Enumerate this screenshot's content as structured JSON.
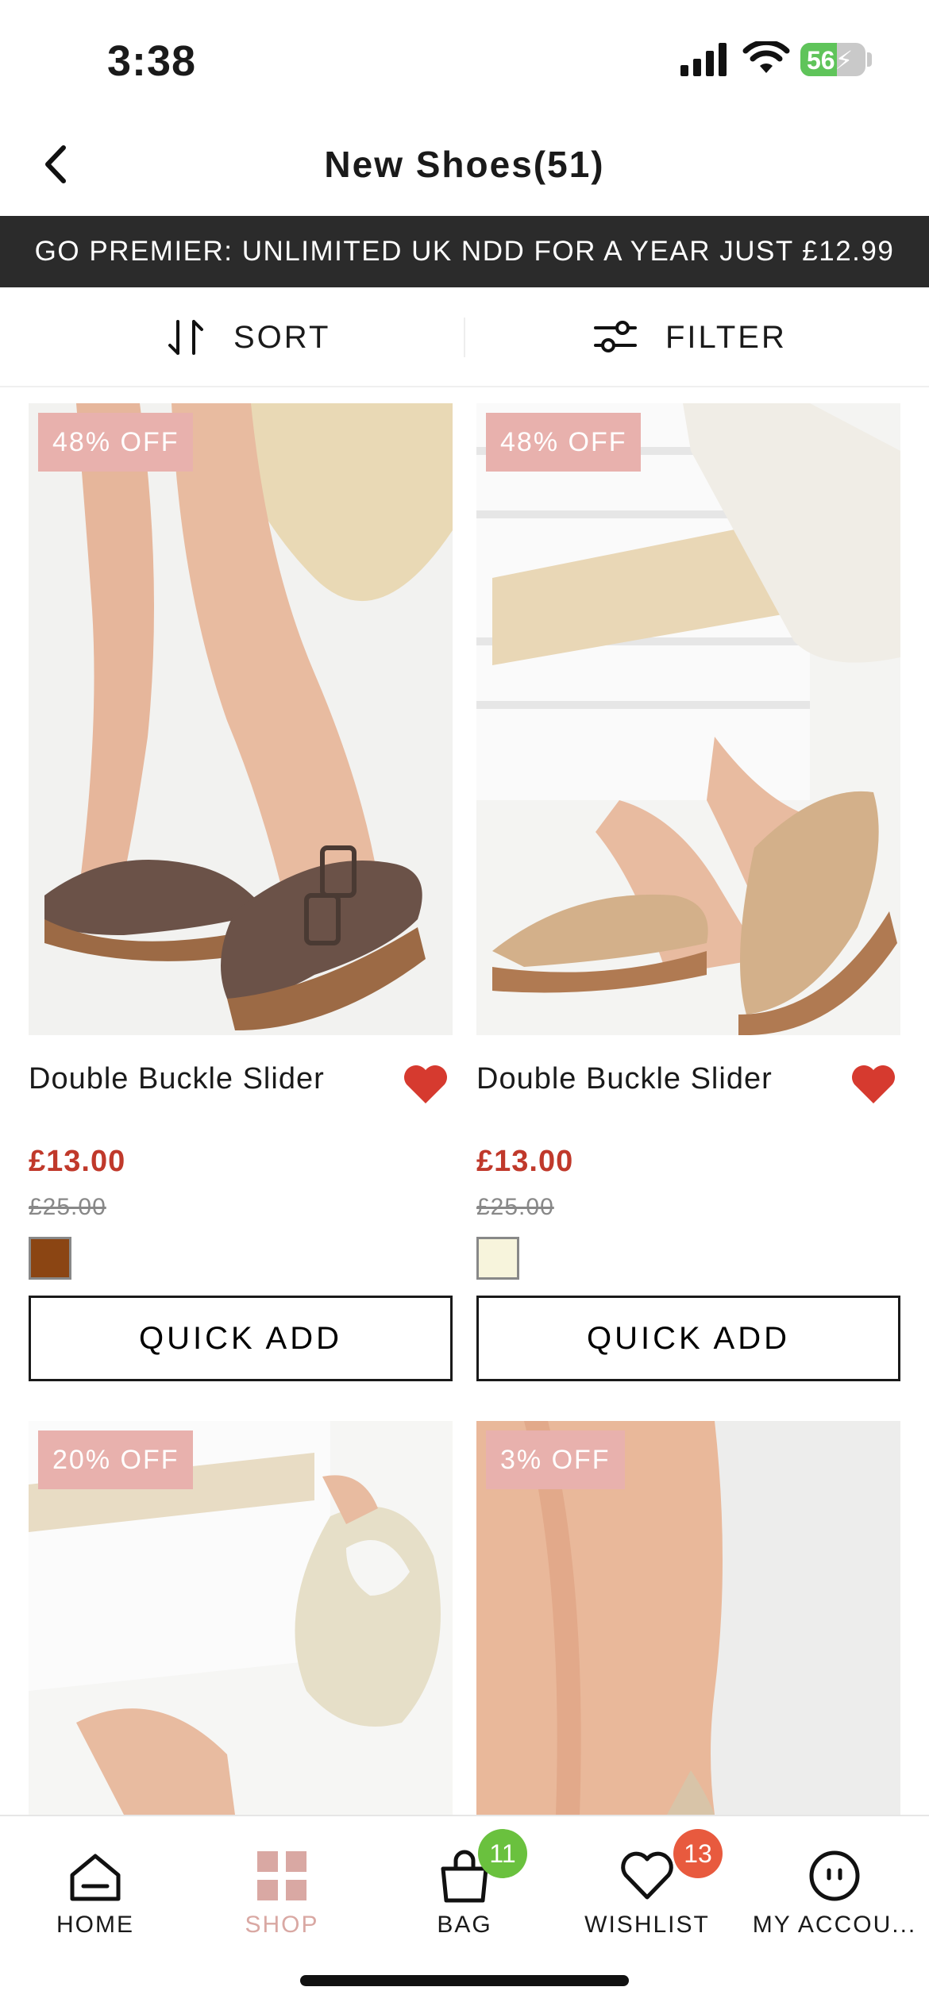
{
  "status_bar": {
    "time": "3:38",
    "battery": "56"
  },
  "header": {
    "title": "New Shoes(51)"
  },
  "promo": {
    "text": "GO PREMIER: UNLIMITED UK NDD FOR A YEAR JUST £12.99"
  },
  "toolbar": {
    "sort_label": "SORT",
    "filter_label": "FILTER"
  },
  "products": [
    {
      "badge": "48% OFF",
      "name": "Double Buckle Slider",
      "price": "£13.00",
      "was_price": "£25.00",
      "swatch_color": "#8b4513",
      "quick_add": "QUICK ADD",
      "wishlisted": true
    },
    {
      "badge": "48% OFF",
      "name": "Double Buckle Slider",
      "price": "£13.00",
      "was_price": "£25.00",
      "swatch_color": "#f7f4dc",
      "quick_add": "QUICK ADD",
      "wishlisted": true
    },
    {
      "badge": "20% OFF"
    },
    {
      "badge": "3% OFF"
    }
  ],
  "nav": {
    "items": [
      {
        "label": "HOME",
        "icon": "home-icon"
      },
      {
        "label": "SHOP",
        "icon": "grid-icon"
      },
      {
        "label": "BAG",
        "icon": "bag-icon",
        "badge": "11",
        "badge_color": "#6ac13e"
      },
      {
        "label": "WISHLIST",
        "icon": "heart-icon",
        "badge": "13",
        "badge_color": "#e85a3e"
      },
      {
        "label": "MY ACCOU...",
        "icon": "account-icon"
      }
    ]
  },
  "colors": {
    "price": "#c0392b",
    "badge": "#e8b1ad",
    "heart": "#d63a2f",
    "shop_active": "#d9a8a3"
  }
}
